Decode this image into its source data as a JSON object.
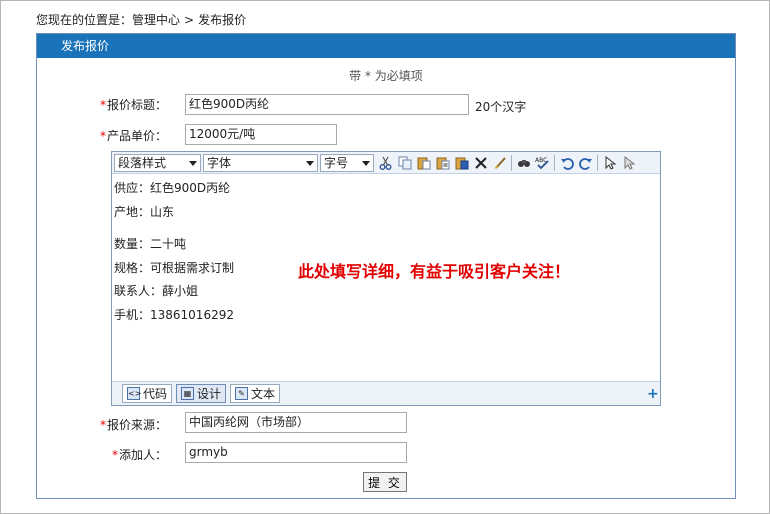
{
  "breadcrumb": {
    "prefix": "您现在的位置是：",
    "home": "管理中心",
    "separator": ">",
    "current": "发布报价"
  },
  "panel": {
    "title": "发布报价",
    "required_note": "带 * 为必填项"
  },
  "form": {
    "required_mark": "*",
    "title": {
      "label": "报价标题：",
      "value": "红色900D丙纶",
      "hint": "20个汉字"
    },
    "price": {
      "label": "产品单价：",
      "value": "12000元/吨"
    },
    "source": {
      "label": "报价来源：",
      "value": "中国丙纶网（市场部）"
    },
    "adder": {
      "label": "添加人：",
      "value": "grmyb"
    },
    "submit_label": "提 交"
  },
  "editor": {
    "toolbar": {
      "paragraph_style": "段落样式",
      "font": "字体",
      "font_size": "字号"
    },
    "content_lines": [
      "供应：红色900D丙纶",
      "产地：山东",
      "数量：二十吨",
      "规格：可根据需求订制",
      "联系人：薛小姐",
      "手机：13861016292"
    ],
    "promo_text": "此处填写详细，有益于吸引客户关注！",
    "modes": {
      "code": "代码",
      "design": "设计",
      "text": "文本"
    }
  },
  "colors": {
    "header_bg": "#1a72b9",
    "required_star": "#e00000",
    "promo": "#e00000"
  }
}
